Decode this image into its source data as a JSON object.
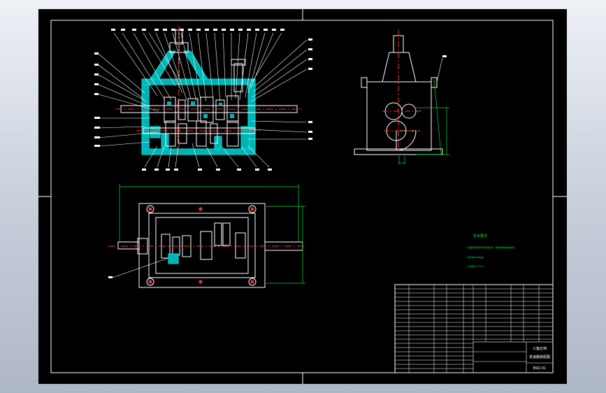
{
  "colors": {
    "background": "#000000",
    "frame": "#ffffff",
    "section_fill": "#00b4b4",
    "center_line": "#ff3030",
    "dimension": "#00e040",
    "leader": "#ffffff",
    "outer_area": "#c4ccd8"
  },
  "notes": {
    "title": "技术要求",
    "items": [
      "1.装配前所有零件用煤油清洗，箱体内壁涂耐油油漆。",
      "2.箱内装N68机油。",
      "3.试运转不少于2h。"
    ]
  },
  "title_block": {
    "product_name_line1": "三轴五档",
    "product_name_line2": "变速器装配图",
    "drawing_number": "BSQ-01"
  },
  "icons": [
    "sectioned-front-view",
    "side-view",
    "top-view",
    "bill-of-materials"
  ]
}
